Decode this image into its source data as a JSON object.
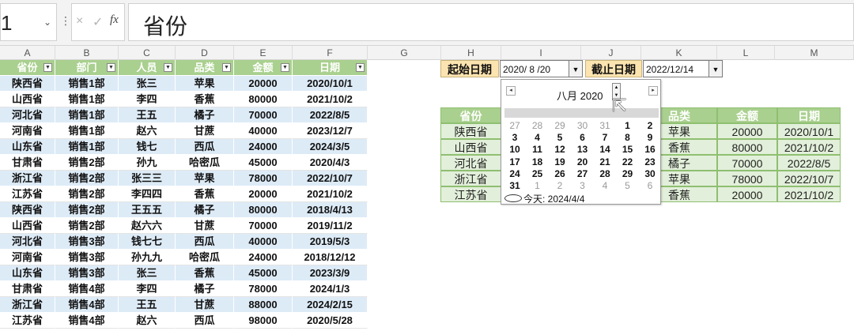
{
  "namebox": {
    "value": "1"
  },
  "formula_bar": {
    "content": "省份",
    "cancel_glyph": "×",
    "enter_glyph": "✓",
    "fx_label": "fx"
  },
  "columns": [
    "A",
    "B",
    "C",
    "D",
    "E",
    "F",
    "G",
    "H",
    "I",
    "J",
    "K",
    "L",
    "M"
  ],
  "left_table": {
    "headers": [
      "省份",
      "部门",
      "人员",
      "品类",
      "金额",
      "日期"
    ],
    "rows": [
      [
        "陕西省",
        "销售1部",
        "张三",
        "苹果",
        "20000",
        "2020/10/1"
      ],
      [
        "山西省",
        "销售1部",
        "李四",
        "香蕉",
        "80000",
        "2021/10/2"
      ],
      [
        "河北省",
        "销售1部",
        "王五",
        "橘子",
        "70000",
        "2022/8/5"
      ],
      [
        "河南省",
        "销售1部",
        "赵六",
        "甘蔗",
        "40000",
        "2023/12/7"
      ],
      [
        "山东省",
        "销售1部",
        "钱七",
        "西瓜",
        "24000",
        "2024/3/5"
      ],
      [
        "甘肃省",
        "销售2部",
        "孙九",
        "哈密瓜",
        "45000",
        "2020/4/3"
      ],
      [
        "浙江省",
        "销售2部",
        "张三三",
        "苹果",
        "78000",
        "2022/10/7"
      ],
      [
        "江苏省",
        "销售2部",
        "李四四",
        "香蕉",
        "20000",
        "2021/10/2"
      ],
      [
        "陕西省",
        "销售2部",
        "王五五",
        "橘子",
        "80000",
        "2018/4/13"
      ],
      [
        "山西省",
        "销售2部",
        "赵六六",
        "甘蔗",
        "70000",
        "2019/11/2"
      ],
      [
        "河北省",
        "销售3部",
        "钱七七",
        "西瓜",
        "40000",
        "2019/5/3"
      ],
      [
        "河南省",
        "销售3部",
        "孙九九",
        "哈密瓜",
        "24000",
        "2018/12/12"
      ],
      [
        "山东省",
        "销售3部",
        "张三",
        "香蕉",
        "45000",
        "2023/3/9"
      ],
      [
        "甘肃省",
        "销售4部",
        "李四",
        "橘子",
        "78000",
        "2024/1/3"
      ],
      [
        "浙江省",
        "销售4部",
        "王五",
        "甘蔗",
        "88000",
        "2024/2/15"
      ],
      [
        "江苏省",
        "销售4部",
        "赵六",
        "西瓜",
        "98000",
        "2020/5/28"
      ]
    ]
  },
  "date_filter": {
    "start_label": "起始日期",
    "start_value": "2020/ 8 /20",
    "end_label": "截止日期",
    "end_value": "2022/12/14",
    "dropdown_glyph": "▼"
  },
  "result_table": {
    "headers": [
      "省份",
      "",
      "",
      "品类",
      "金额",
      "日期"
    ],
    "rows": [
      [
        "陕西省",
        "苹果",
        "20000",
        "2020/10/1"
      ],
      [
        "山西省",
        "香蕉",
        "80000",
        "2021/10/2"
      ],
      [
        "河北省",
        "橘子",
        "70000",
        "2022/8/5"
      ],
      [
        "浙江省",
        "苹果",
        "78000",
        "2022/10/7"
      ],
      [
        "江苏省",
        "香蕉",
        "20000",
        "2021/10/2"
      ]
    ]
  },
  "calendar": {
    "month_label": "八月 2020",
    "prev_glyph": "◂",
    "next_glyph": "▸",
    "weeks": [
      [
        "27",
        "28",
        "29",
        "30",
        "31",
        "1",
        "2"
      ],
      [
        "3",
        "4",
        "5",
        "6",
        "7",
        "8",
        "9"
      ],
      [
        "10",
        "11",
        "12",
        "13",
        "14",
        "15",
        "16"
      ],
      [
        "17",
        "18",
        "19",
        "20",
        "21",
        "22",
        "23"
      ],
      [
        "24",
        "25",
        "26",
        "27",
        "28",
        "29",
        "30"
      ],
      [
        "31",
        "1",
        "2",
        "3",
        "4",
        "5",
        "6"
      ]
    ],
    "today_label": "今天: 2024/4/4"
  }
}
